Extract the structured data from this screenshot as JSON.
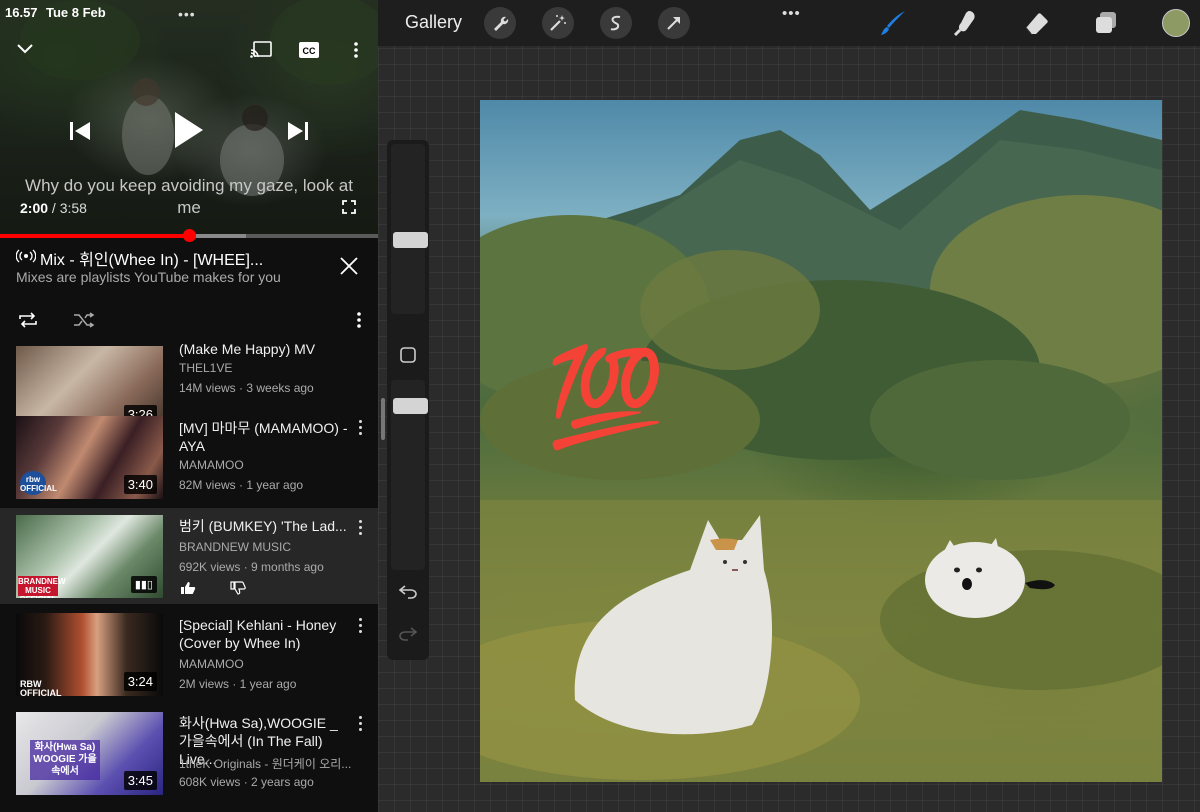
{
  "status": {
    "time": "16.57",
    "date": "Tue 8 Feb"
  },
  "player": {
    "lyric": "Why do you keep avoiding my gaze, look at me",
    "current_time": "2:00",
    "separator": "/",
    "duration": "3:58",
    "progress": 0.5,
    "buffered": 0.65
  },
  "mix": {
    "title": "Mix - 휘인(Whee In) - [WHEE]...",
    "subtitle": "Mixes are playlists YouTube makes for you"
  },
  "playlist": [
    {
      "title": "(Make Me Happy) MV",
      "channel": "THEL1VE",
      "meta": "14M views · 3 weeks ago",
      "duration": "3:26",
      "active": false
    },
    {
      "title": "[MV] 마마무 (MAMAMOO) - AYA",
      "channel": "MAMAMOO",
      "meta": "82M views · 1 year ago",
      "duration": "3:40",
      "active": false,
      "thumb_logo": "rbw OFFICIAL"
    },
    {
      "title": "범키 (BUMKEY) 'The Lad...",
      "channel": "BRANDNEW MUSIC",
      "meta": "692K views · 9 months ago",
      "duration": "",
      "active": true,
      "thumb_logo": "BRANDNEW MUSIC OFFICIAL"
    },
    {
      "title": "[Special] Kehlani - Honey (Cover by Whee In)",
      "channel": "MAMAMOO",
      "meta": "2M views · 1 year ago",
      "duration": "3:24",
      "active": false,
      "thumb_logo": "RBW OFFICIAL"
    },
    {
      "title": "화사(Hwa Sa),WOOGIE _ 가을속에서 (In The Fall) Live...",
      "channel": "1theK Originals - 원더케이 오리...",
      "meta": "608K views · 2 years ago",
      "duration": "3:45",
      "active": false,
      "thumb_logo": "화사(Hwa Sa) WOOGIE 가을속에서"
    }
  ],
  "procreate": {
    "gallery_label": "Gallery",
    "current_color": "#8e9a63",
    "brush_color": "#1f7fe0",
    "canvas_emoji": "💯"
  },
  "colors": {
    "accent": "#ff0000",
    "panel": "#0f0f0f",
    "active_row": "#272727"
  }
}
